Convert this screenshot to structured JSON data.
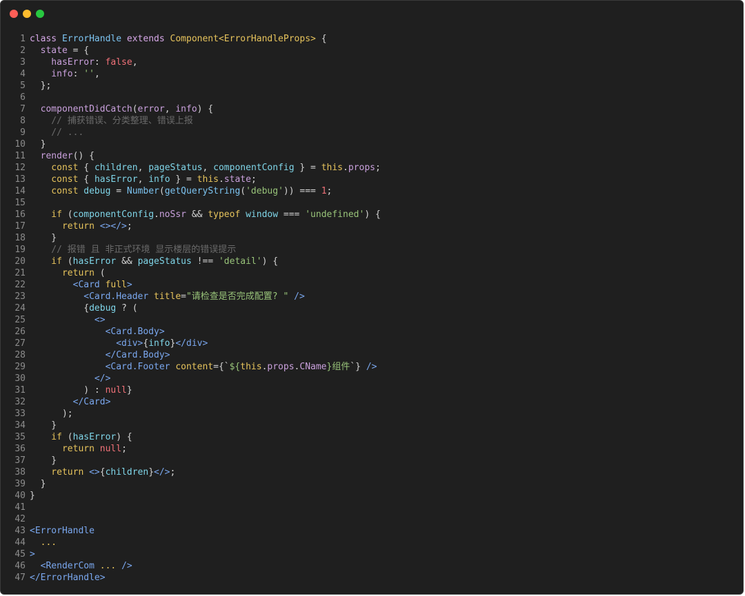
{
  "window": {
    "controls": [
      {
        "name": "close",
        "color": "#ff5f57"
      },
      {
        "name": "minimize",
        "color": "#febc2e"
      },
      {
        "name": "maximize",
        "color": "#28c840"
      }
    ]
  },
  "code": {
    "lines": [
      [
        {
          "t": "class ",
          "c": "kw"
        },
        {
          "t": "ErrorHandle ",
          "c": "fn"
        },
        {
          "t": "extends ",
          "c": "kw"
        },
        {
          "t": "Component",
          "c": "cls"
        },
        {
          "t": "<ErrorHandleProps> ",
          "c": "cls"
        },
        {
          "t": "{",
          "c": "pl"
        }
      ],
      [
        {
          "t": "  state ",
          "c": "prop"
        },
        {
          "t": "= {",
          "c": "pl"
        }
      ],
      [
        {
          "t": "    hasError",
          "c": "prop"
        },
        {
          "t": ": ",
          "c": "pl"
        },
        {
          "t": "false",
          "c": "bool"
        },
        {
          "t": ",",
          "c": "pl"
        }
      ],
      [
        {
          "t": "    info",
          "c": "prop"
        },
        {
          "t": ": ",
          "c": "pl"
        },
        {
          "t": "''",
          "c": "str"
        },
        {
          "t": ",",
          "c": "pl"
        }
      ],
      [
        {
          "t": "  };",
          "c": "pl"
        }
      ],
      [],
      [
        {
          "t": "  componentDidCatch",
          "c": "prop"
        },
        {
          "t": "(",
          "c": "pl"
        },
        {
          "t": "error",
          "c": "prop"
        },
        {
          "t": ", ",
          "c": "pl"
        },
        {
          "t": "info",
          "c": "prop"
        },
        {
          "t": ") {",
          "c": "pl"
        }
      ],
      [
        {
          "t": "    // 捕获错误、分类整理、错误上报",
          "c": "cmt"
        }
      ],
      [
        {
          "t": "    // ...",
          "c": "cmt"
        }
      ],
      [
        {
          "t": "  }",
          "c": "pl"
        }
      ],
      [
        {
          "t": "  render",
          "c": "prop"
        },
        {
          "t": "() {",
          "c": "pl"
        }
      ],
      [
        {
          "t": "    const ",
          "c": "cls"
        },
        {
          "t": "{ ",
          "c": "pl"
        },
        {
          "t": "children",
          "c": "var"
        },
        {
          "t": ", ",
          "c": "pl"
        },
        {
          "t": "pageStatus",
          "c": "var"
        },
        {
          "t": ", ",
          "c": "pl"
        },
        {
          "t": "componentConfig",
          "c": "var"
        },
        {
          "t": " } = ",
          "c": "pl"
        },
        {
          "t": "this",
          "c": "cls"
        },
        {
          "t": ".",
          "c": "pl"
        },
        {
          "t": "props",
          "c": "prop"
        },
        {
          "t": ";",
          "c": "pl"
        }
      ],
      [
        {
          "t": "    const ",
          "c": "cls"
        },
        {
          "t": "{ ",
          "c": "pl"
        },
        {
          "t": "hasError",
          "c": "var"
        },
        {
          "t": ", ",
          "c": "pl"
        },
        {
          "t": "info",
          "c": "var"
        },
        {
          "t": " } = ",
          "c": "pl"
        },
        {
          "t": "this",
          "c": "cls"
        },
        {
          "t": ".",
          "c": "pl"
        },
        {
          "t": "state",
          "c": "prop"
        },
        {
          "t": ";",
          "c": "pl"
        }
      ],
      [
        {
          "t": "    const ",
          "c": "cls"
        },
        {
          "t": "debug",
          "c": "var"
        },
        {
          "t": " = ",
          "c": "pl"
        },
        {
          "t": "Number",
          "c": "fn"
        },
        {
          "t": "(",
          "c": "pl"
        },
        {
          "t": "getQueryString",
          "c": "fn"
        },
        {
          "t": "(",
          "c": "pl"
        },
        {
          "t": "'debug'",
          "c": "str"
        },
        {
          "t": ")) === ",
          "c": "pl"
        },
        {
          "t": "1",
          "c": "bool"
        },
        {
          "t": ";",
          "c": "pl"
        }
      ],
      [],
      [
        {
          "t": "    if ",
          "c": "cls"
        },
        {
          "t": "(",
          "c": "pl"
        },
        {
          "t": "componentConfig",
          "c": "var"
        },
        {
          "t": ".",
          "c": "pl"
        },
        {
          "t": "noSsr",
          "c": "prop"
        },
        {
          "t": " && ",
          "c": "pl"
        },
        {
          "t": "typeof ",
          "c": "cls"
        },
        {
          "t": "window",
          "c": "var"
        },
        {
          "t": " === ",
          "c": "pl"
        },
        {
          "t": "'undefined'",
          "c": "str"
        },
        {
          "t": ") {",
          "c": "pl"
        }
      ],
      [
        {
          "t": "      return ",
          "c": "cls"
        },
        {
          "t": "<></>",
          "c": "tag"
        },
        {
          "t": ";",
          "c": "pl"
        }
      ],
      [
        {
          "t": "    }",
          "c": "pl"
        }
      ],
      [
        {
          "t": "    // 报错 且 非正式环境 显示楼层的错误提示",
          "c": "cmt"
        }
      ],
      [
        {
          "t": "    if ",
          "c": "cls"
        },
        {
          "t": "(",
          "c": "pl"
        },
        {
          "t": "hasError",
          "c": "var"
        },
        {
          "t": " && ",
          "c": "pl"
        },
        {
          "t": "pageStatus",
          "c": "var"
        },
        {
          "t": " !== ",
          "c": "pl"
        },
        {
          "t": "'detail'",
          "c": "str"
        },
        {
          "t": ") {",
          "c": "pl"
        }
      ],
      [
        {
          "t": "      return ",
          "c": "cls"
        },
        {
          "t": "(",
          "c": "pl"
        }
      ],
      [
        {
          "t": "        <Card ",
          "c": "tag"
        },
        {
          "t": "full",
          "c": "attr"
        },
        {
          "t": ">",
          "c": "tag"
        }
      ],
      [
        {
          "t": "          <Card.Header ",
          "c": "tag"
        },
        {
          "t": "title",
          "c": "attr"
        },
        {
          "t": "=",
          "c": "pl"
        },
        {
          "t": "\"请检查是否完成配置? \"",
          "c": "str"
        },
        {
          "t": " />",
          "c": "tag"
        }
      ],
      [
        {
          "t": "          {",
          "c": "pl"
        },
        {
          "t": "debug",
          "c": "var"
        },
        {
          "t": " ? (",
          "c": "pl"
        }
      ],
      [
        {
          "t": "            <>",
          "c": "tag"
        }
      ],
      [
        {
          "t": "              <Card.Body>",
          "c": "tag"
        }
      ],
      [
        {
          "t": "                <div>",
          "c": "tag"
        },
        {
          "t": "{",
          "c": "pl"
        },
        {
          "t": "info",
          "c": "var"
        },
        {
          "t": "}",
          "c": "pl"
        },
        {
          "t": "</div>",
          "c": "tag"
        }
      ],
      [
        {
          "t": "              </Card.Body>",
          "c": "tag"
        }
      ],
      [
        {
          "t": "              <Card.Footer ",
          "c": "tag"
        },
        {
          "t": "content",
          "c": "attr"
        },
        {
          "t": "={`",
          "c": "pl"
        },
        {
          "t": "${",
          "c": "str"
        },
        {
          "t": "this",
          "c": "cls"
        },
        {
          "t": ".",
          "c": "pl"
        },
        {
          "t": "props",
          "c": "prop"
        },
        {
          "t": ".",
          "c": "pl"
        },
        {
          "t": "CName",
          "c": "prop"
        },
        {
          "t": "}组件",
          "c": "str"
        },
        {
          "t": "`}",
          "c": "pl"
        },
        {
          "t": " />",
          "c": "tag"
        }
      ],
      [
        {
          "t": "            </>",
          "c": "tag"
        }
      ],
      [
        {
          "t": "          ) : ",
          "c": "pl"
        },
        {
          "t": "null",
          "c": "bool"
        },
        {
          "t": "}",
          "c": "pl"
        }
      ],
      [
        {
          "t": "        </Card>",
          "c": "tag"
        }
      ],
      [
        {
          "t": "      );",
          "c": "pl"
        }
      ],
      [
        {
          "t": "    }",
          "c": "pl"
        }
      ],
      [
        {
          "t": "    if ",
          "c": "cls"
        },
        {
          "t": "(",
          "c": "pl"
        },
        {
          "t": "hasError",
          "c": "var"
        },
        {
          "t": ") {",
          "c": "pl"
        }
      ],
      [
        {
          "t": "      return ",
          "c": "cls"
        },
        {
          "t": "null",
          "c": "bool"
        },
        {
          "t": ";",
          "c": "pl"
        }
      ],
      [
        {
          "t": "    }",
          "c": "pl"
        }
      ],
      [
        {
          "t": "    return ",
          "c": "cls"
        },
        {
          "t": "<>",
          "c": "tag"
        },
        {
          "t": "{",
          "c": "pl"
        },
        {
          "t": "children",
          "c": "var"
        },
        {
          "t": "}",
          "c": "pl"
        },
        {
          "t": "</>",
          "c": "tag"
        },
        {
          "t": ";",
          "c": "pl"
        }
      ],
      [
        {
          "t": "  }",
          "c": "pl"
        }
      ],
      [
        {
          "t": "}",
          "c": "pl"
        }
      ],
      [],
      [],
      [
        {
          "t": "<ErrorHandle",
          "c": "tag"
        }
      ],
      [
        {
          "t": "  ...",
          "c": "cls"
        }
      ],
      [
        {
          "t": ">",
          "c": "tag"
        }
      ],
      [
        {
          "t": "  <RenderCom ",
          "c": "tag"
        },
        {
          "t": "... ",
          "c": "cls"
        },
        {
          "t": "/>",
          "c": "tag"
        }
      ],
      [
        {
          "t": "</ErrorHandle>",
          "c": "tag"
        }
      ]
    ]
  }
}
